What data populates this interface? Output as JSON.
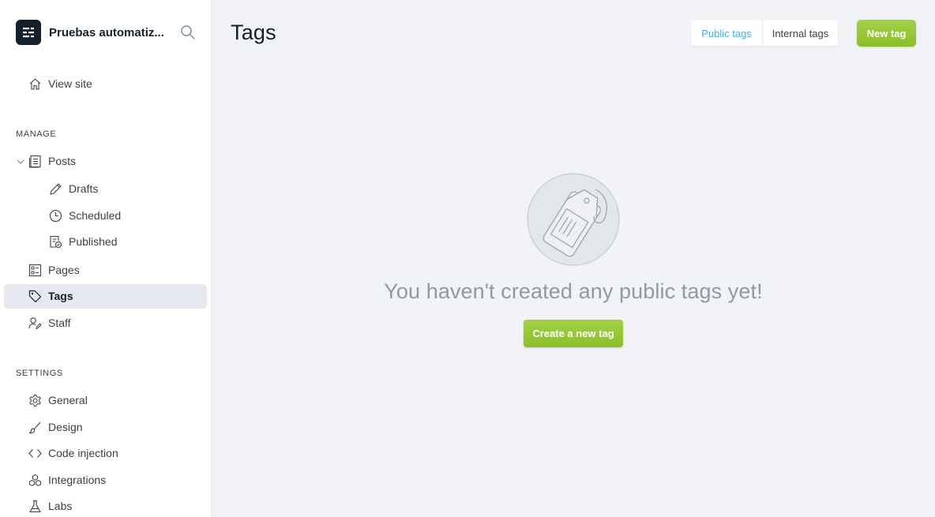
{
  "sidebar": {
    "site_title": "Pruebas automatiz...",
    "view_site": "View site",
    "manage_title": "MANAGE",
    "posts": "Posts",
    "drafts": "Drafts",
    "scheduled": "Scheduled",
    "published": "Published",
    "pages": "Pages",
    "tags": "Tags",
    "staff": "Staff",
    "settings_title": "SETTINGS",
    "general": "General",
    "design": "Design",
    "code_injection": "Code injection",
    "integrations": "Integrations",
    "labs": "Labs",
    "icons": [
      "ghost-logo-icon",
      "search-icon",
      "home-icon",
      "chevron-down-icon",
      "posts-icon",
      "pencil-icon",
      "clock-icon",
      "published-icon",
      "pages-icon",
      "tag-icon",
      "staff-icon",
      "gear-icon",
      "brush-icon",
      "code-icon",
      "integrations-icon",
      "flask-icon"
    ]
  },
  "header": {
    "title": "Tags",
    "tab_public": "Public tags",
    "tab_internal": "Internal tags",
    "new_tag_label": "New tag"
  },
  "empty_state": {
    "message": "You haven't created any public tags yet!",
    "create_label": "Create a new tag"
  },
  "colors": {
    "accent_green": "#9fcd3f",
    "link_blue": "#3eb0ef",
    "sidebar_bg": "#ffffff",
    "main_bg": "#f1f3f7"
  }
}
